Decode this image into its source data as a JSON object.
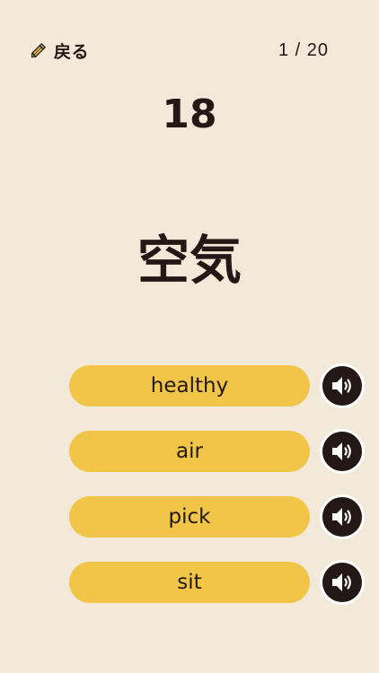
{
  "header": {
    "back_icon": "pencil-icon",
    "back_label": "戻る",
    "progress": "1 / 20"
  },
  "timer": "18",
  "question": {
    "word": "空気"
  },
  "choices": [
    {
      "label": "healthy",
      "audio_icon": "speaker-icon"
    },
    {
      "label": "air",
      "audio_icon": "speaker-icon"
    },
    {
      "label": "pick",
      "audio_icon": "speaker-icon"
    },
    {
      "label": "sit",
      "audio_icon": "speaker-icon"
    }
  ],
  "colors": {
    "background": "#f2e9d9",
    "choice_button": "#f0c548",
    "text": "#231815",
    "speaker_bg": "#231815"
  }
}
